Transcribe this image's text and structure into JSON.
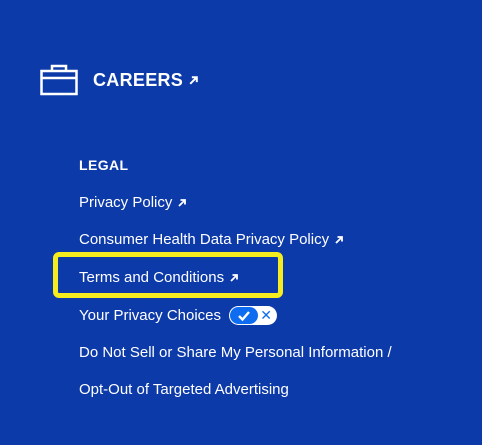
{
  "careers": {
    "label": "CAREERS",
    "icon": "briefcase-icon",
    "link_icon": "external-arrow-icon"
  },
  "legal": {
    "heading": "LEGAL",
    "links": [
      {
        "label": "Privacy Policy",
        "external": true
      },
      {
        "label": "Consumer Health Data Privacy Policy",
        "external": true
      },
      {
        "label": "Terms and Conditions",
        "external": true,
        "highlighted": true
      },
      {
        "label": "Your Privacy Choices",
        "toggle_icon": "privacy-choices-toggle-icon"
      },
      {
        "label": "Do Not Sell or Share My Personal Information /"
      },
      {
        "label": "Opt-Out of Targeted Advertising"
      }
    ]
  },
  "colors": {
    "background": "#0d3aa9",
    "text": "#ffffff",
    "highlight": "#f5ec20",
    "toggle_accent": "#0d6cf0"
  }
}
